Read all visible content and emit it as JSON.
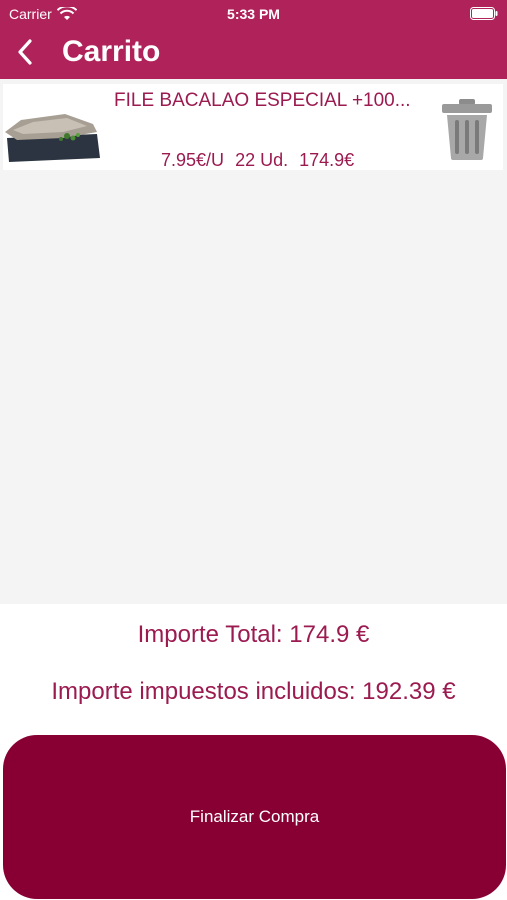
{
  "status_bar": {
    "carrier": "Carrier",
    "time": "5:33 PM",
    "icons": [
      "wifi-icon",
      "battery-icon"
    ]
  },
  "nav": {
    "title": "Carrito",
    "back_icon": "chevron-left-icon"
  },
  "cart": {
    "items": [
      {
        "name": "FILE BACALAO ESPECIAL +100...",
        "unit_price": "7.95€/U",
        "quantity": "22 Ud.",
        "subtotal": "174.9€",
        "delete_icon": "trash-icon"
      }
    ]
  },
  "totals": {
    "total_label": "Importe Total: 174.9 €",
    "tax_label": "Importe impuestos incluidos: 192.39 €"
  },
  "checkout": {
    "label": "Finalizar Compra"
  },
  "colors": {
    "header": "#b0235a",
    "accent_text": "#9b1b50",
    "button": "#880033",
    "list_bg": "#f4f4f4"
  }
}
